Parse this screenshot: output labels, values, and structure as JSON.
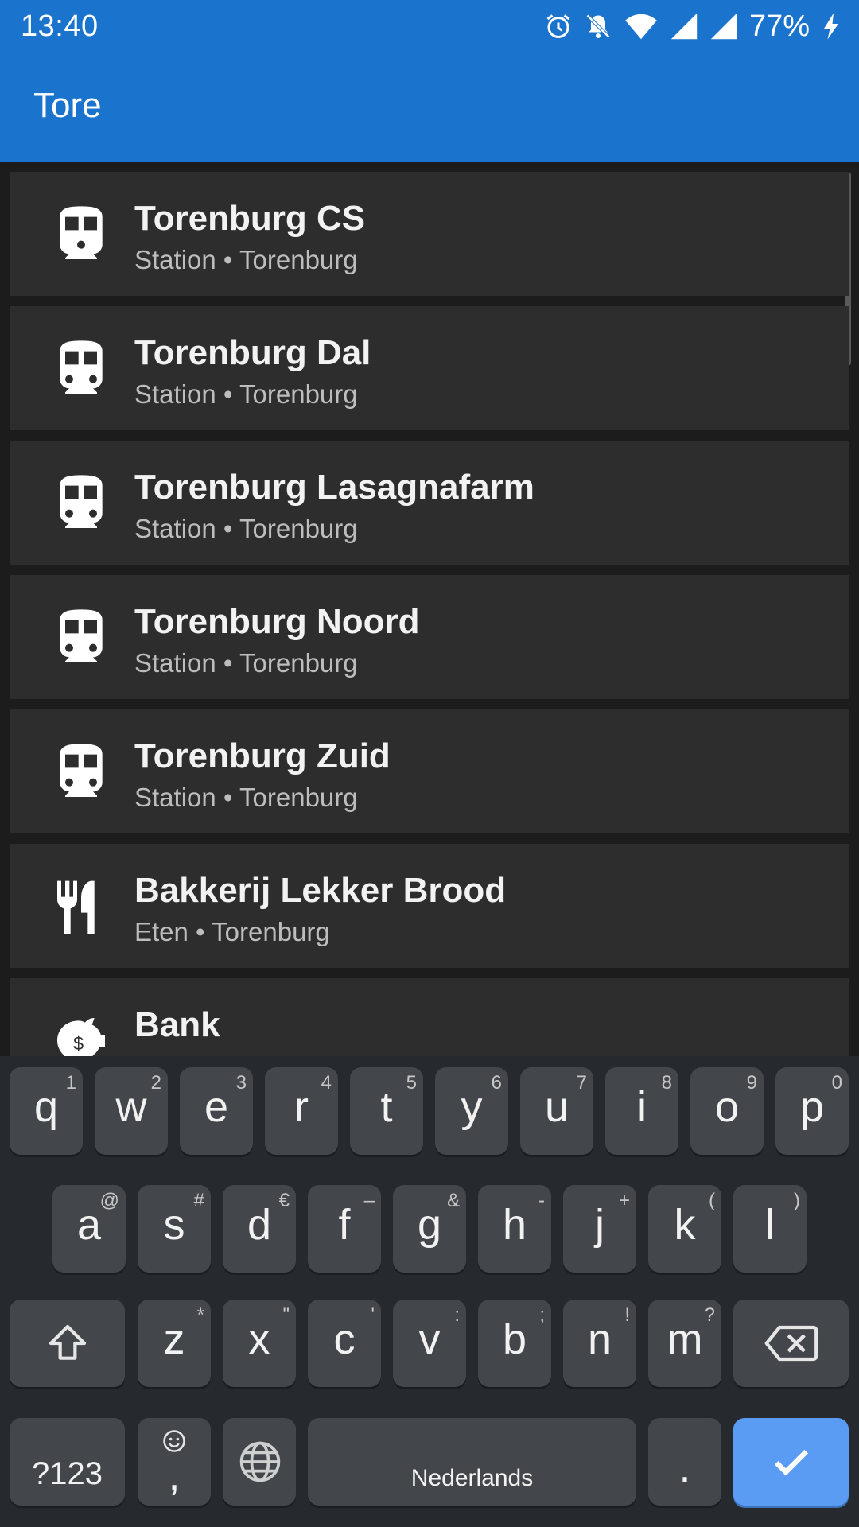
{
  "status_bar": {
    "time": "13:40",
    "battery_percent": "77%",
    "icons": [
      "alarm-icon",
      "notifications-off-icon",
      "wifi-icon",
      "cell-signal-icon",
      "cell-signal-icon",
      "battery-charging-icon"
    ]
  },
  "app_bar": {
    "search_text": "Tore"
  },
  "results": [
    {
      "title": "Torenburg CS",
      "subtitle": "Station • Torenburg",
      "icon": "train-icon"
    },
    {
      "title": "Torenburg Dal",
      "subtitle": "Station • Torenburg",
      "icon": "train-icon"
    },
    {
      "title": "Torenburg Lasagnafarm",
      "subtitle": "Station • Torenburg",
      "icon": "train-icon"
    },
    {
      "title": "Torenburg Noord",
      "subtitle": "Station • Torenburg",
      "icon": "train-icon"
    },
    {
      "title": "Torenburg Zuid",
      "subtitle": "Station • Torenburg",
      "icon": "train-icon"
    },
    {
      "title": "Bakkerij Lekker Brood",
      "subtitle": "Eten • Torenburg",
      "icon": "restaurant-icon"
    },
    {
      "title": "Bank",
      "subtitle": "",
      "icon": "piggy-bank-icon"
    }
  ],
  "keyboard": {
    "row1": [
      {
        "key": "q",
        "hint": "1"
      },
      {
        "key": "w",
        "hint": "2"
      },
      {
        "key": "e",
        "hint": "3"
      },
      {
        "key": "r",
        "hint": "4"
      },
      {
        "key": "t",
        "hint": "5"
      },
      {
        "key": "y",
        "hint": "6"
      },
      {
        "key": "u",
        "hint": "7"
      },
      {
        "key": "i",
        "hint": "8"
      },
      {
        "key": "o",
        "hint": "9"
      },
      {
        "key": "p",
        "hint": "0"
      }
    ],
    "row2": [
      {
        "key": "a",
        "hint": "@"
      },
      {
        "key": "s",
        "hint": "#"
      },
      {
        "key": "d",
        "hint": "€"
      },
      {
        "key": "f",
        "hint": "–"
      },
      {
        "key": "g",
        "hint": "&"
      },
      {
        "key": "h",
        "hint": "-"
      },
      {
        "key": "j",
        "hint": "+"
      },
      {
        "key": "k",
        "hint": "("
      },
      {
        "key": "l",
        "hint": ")"
      }
    ],
    "row3": [
      {
        "key": "z",
        "hint": "*"
      },
      {
        "key": "x",
        "hint": "\""
      },
      {
        "key": "c",
        "hint": "'"
      },
      {
        "key": "v",
        "hint": ":"
      },
      {
        "key": "b",
        "hint": ";"
      },
      {
        "key": "n",
        "hint": "!"
      },
      {
        "key": "m",
        "hint": "?"
      }
    ],
    "symbols_label": "?123",
    "comma_label": ",",
    "space_label": "Nederlands",
    "period_label": ".",
    "shift_icon": "shift-icon",
    "backspace_icon": "backspace-icon",
    "emoji_icon": "emoji-icon",
    "language_icon": "globe-icon",
    "enter_icon": "checkmark-icon",
    "enter_color": "#5a9cf3"
  },
  "colors": {
    "app_bar": "#1a73cc",
    "list_item_bg": "#2d2d2d",
    "keyboard_bg": "#262a2e",
    "key_bg": "#43474b"
  }
}
